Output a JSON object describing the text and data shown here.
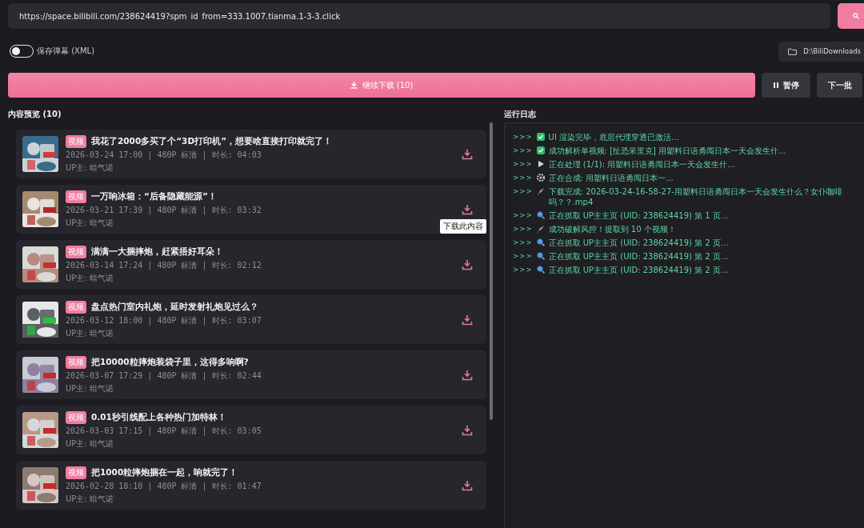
{
  "url_field": {
    "value": "https://space.bilibili.com/238624419?spm_id_from=333.1007.tianma.1-3-3.click"
  },
  "danmaku_toggle": {
    "label": "保存弹幕 (XML)",
    "on": false
  },
  "folder_button": {
    "label": "D:\\BiliDownloads"
  },
  "actions": {
    "main": "继续下载 (10)",
    "pause": "暂停",
    "next": "下一批"
  },
  "preview": {
    "title": "内容预览 (10)",
    "items": [
      {
        "badge": "视频",
        "title": "我花了2000多买了个“3D打印机”，想要啥直接打印就完了！",
        "meta": "2026-03-24 17:00 | 480P 标清 | 时长: 04:03",
        "uploader": "UP主: 暗气诺"
      },
      {
        "badge": "视频",
        "title": "一万响冰箱：“后备隐藏能源”！",
        "meta": "2026-03-21 17:39 | 480P 标清 | 时长: 03:32",
        "uploader": "UP主: 暗气诺",
        "tooltip": "下载此内容"
      },
      {
        "badge": "视频",
        "title": "满满一大捆摔炮，赶紧捂好耳朵！",
        "meta": "2026-03-14 17:24 | 480P 标清 | 时长: 02:12",
        "uploader": "UP主: 暗气诺"
      },
      {
        "badge": "视频",
        "title": "盘点热门室内礼炮，延时发射礼炮见过么？",
        "meta": "2026-03-12 18:00 | 480P 标清 | 时长: 03:07",
        "uploader": "UP主: 暗气诺"
      },
      {
        "badge": "视频",
        "title": "把10000粒摔炮装袋子里，这得多响啊?",
        "meta": "2026-03-07 17:29 | 480P 标清 | 时长: 02:44",
        "uploader": "UP主: 暗气诺"
      },
      {
        "badge": "视频",
        "title": "0.01秒引线配上各种热门加特林！",
        "meta": "2026-03-03 17:15 | 480P 标清 | 时长: 03:05",
        "uploader": "UP主: 暗气诺"
      },
      {
        "badge": "视频",
        "title": "把1000粒摔炮捆在一起，响就完了！",
        "meta": "2026-02-28 18:10 | 480P 标清 | 时长: 01:47",
        "uploader": "UP主: 暗气诺"
      }
    ]
  },
  "log": {
    "title": "运行日志",
    "lines": [
      {
        "prompt": ">>>",
        "kind": "success",
        "text": "UI 渲染完毕，底层代理穿透已激活..."
      },
      {
        "prompt": ">>>",
        "kind": "success",
        "text": "成功解析单视频: [扯恐呆里克] 用塑料日语勇闯日本一天会发生什..."
      },
      {
        "prompt": ">>>",
        "kind": "play",
        "text": "正在处理 (1/1): 用塑料日语勇闯日本一天会发生什..."
      },
      {
        "prompt": ">>>",
        "kind": "gear",
        "text": "正在合成: 用塑料日语勇闯日本一..."
      },
      {
        "prompt": ">>>",
        "kind": "rocket",
        "text": "下载完成: 2026-03-24-16-58-27-用塑料日语勇闯日本一天会发生什么？女仆咖啡吗？？.mp4"
      },
      {
        "prompt": ">>>",
        "kind": "search",
        "text": "正在抓取 UP主主页 (UID: 238624419) 第 1 页..."
      },
      {
        "prompt": ">>>",
        "kind": "rocket",
        "text": "成功破解风控！提取到 10 个视频！"
      },
      {
        "prompt": ">>>",
        "kind": "search",
        "text": "正在抓取 UP主主页 (UID: 238624419) 第 2 页..."
      },
      {
        "prompt": ">>>",
        "kind": "search",
        "text": "正在抓取 UP主主页 (UID: 238624419) 第 2 页..."
      },
      {
        "prompt": ">>>",
        "kind": "search",
        "text": "正在抓取 UP主主页 (UID: 238624419) 第 2 页..."
      }
    ]
  }
}
